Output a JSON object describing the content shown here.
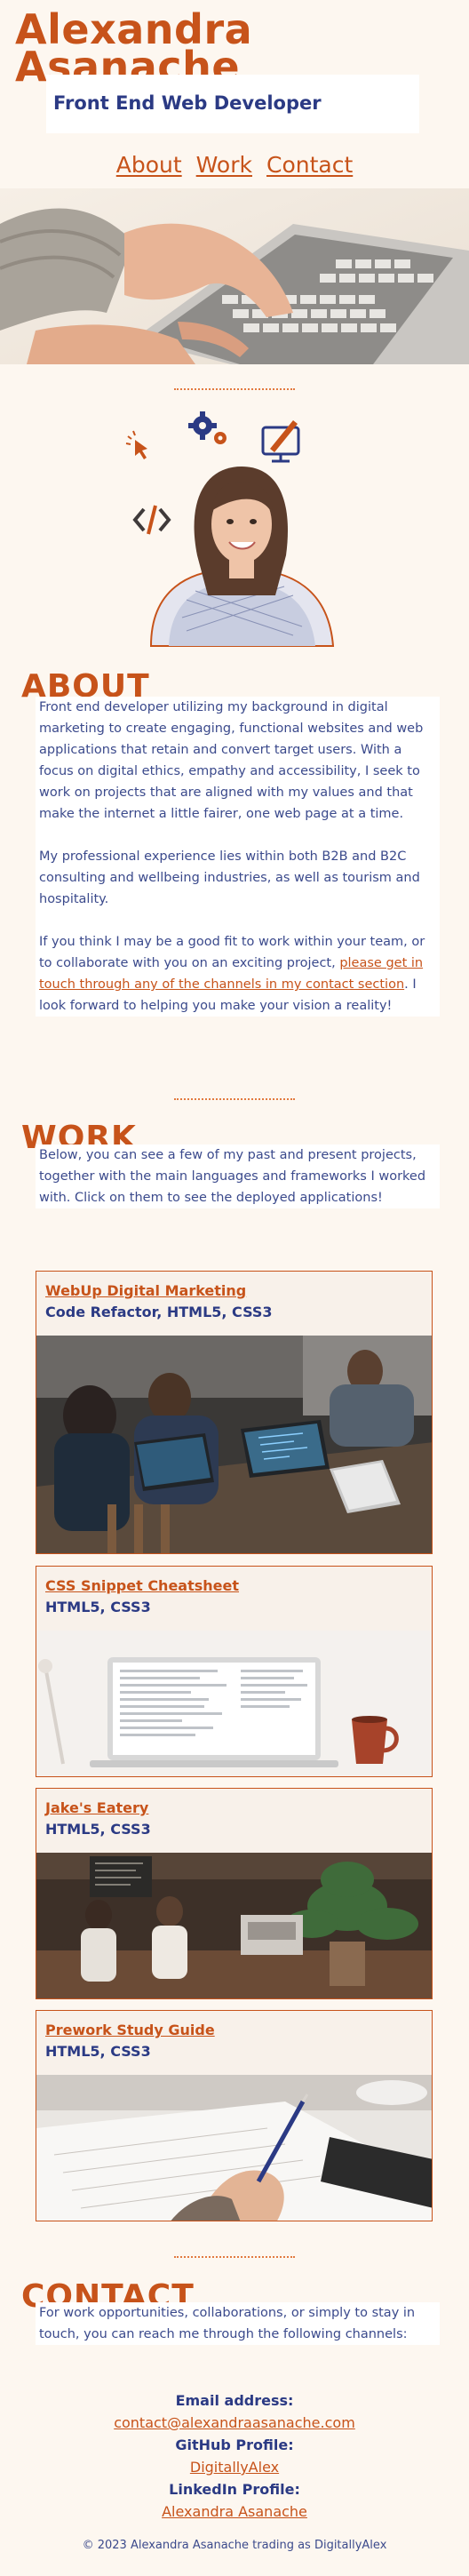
{
  "header": {
    "name_line1": "Alexandra",
    "name_line2": "Asanache",
    "subtitle": "Front End Web Developer"
  },
  "nav": {
    "items": [
      "About",
      "Work",
      "Contact"
    ]
  },
  "about": {
    "heading": "ABOUT",
    "p1": "Front end developer utilizing my background in digital marketing to create engaging, functional websites and web applications that retain and convert target users. With a focus on digital ethics, empathy and accessibility, I seek to work on projects that are aligned with my values and that make the internet a little fairer, one web page at a time.",
    "p2": "My professional experience lies within both B2B and B2C consulting and wellbeing industries, as well as tourism and hospitality.",
    "p3_before": "If you think I may be a good fit to work within your team, or to collaborate with you on an exciting project, ",
    "p3_link": "please get in touch through any of the channels in my contact section",
    "p3_after": ". I look forward to helping you make your vision a reality!"
  },
  "work": {
    "heading": "WORK",
    "intro": "Below, you can see a few of my past and present projects, together with the main languages and frameworks I worked with. Click on them to see the deployed applications!",
    "projects": [
      {
        "title": "WebUp Digital Marketing",
        "tech": "Code Refactor, HTML5, CSS3"
      },
      {
        "title": "CSS Snippet Cheatsheet",
        "tech": "HTML5, CSS3"
      },
      {
        "title": "Jake's Eatery",
        "tech": "HTML5, CSS3"
      },
      {
        "title": "Prework Study Guide",
        "tech": "HTML5, CSS3"
      }
    ]
  },
  "contact": {
    "heading": "CONTACT",
    "intro": "For work opportunities, collaborations, or simply to stay in touch, you can reach me through the following channels:",
    "email_label": "Email address:",
    "email": "contact@alexandraasanache.com",
    "github_label": "GitHub Profile:",
    "github": "DigitallyAlex",
    "linkedin_label": "LinkedIn Profile:",
    "linkedin": "Alexandra Asanache"
  },
  "footer": {
    "text": "© 2023 Alexandra Asanache trading as DigitallyAlex"
  },
  "colors": {
    "accent": "#c7531a",
    "navy": "#2b3a84",
    "background": "#fdf7f0"
  },
  "icons": [
    "cursor-icon",
    "gears-icon",
    "design-monitor-icon",
    "code-brackets-icon"
  ]
}
